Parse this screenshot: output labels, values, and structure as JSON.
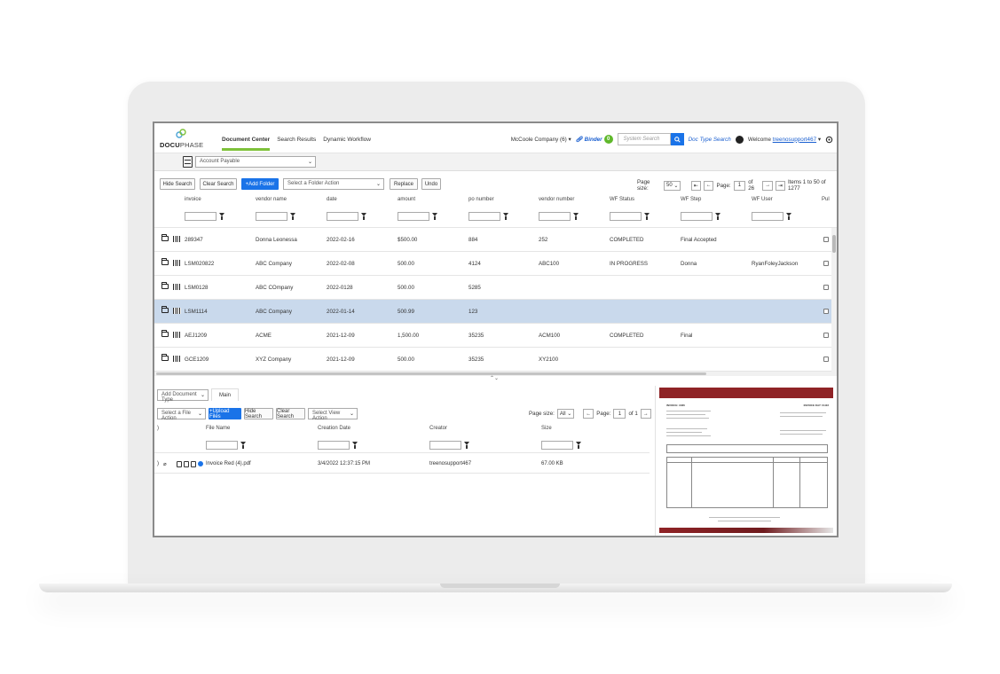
{
  "header": {
    "logo_text_bold": "DOCU",
    "logo_text_rest": "PHASE",
    "tabs": [
      {
        "label": "Document Center",
        "active": true
      },
      {
        "label": "Search Results",
        "active": false
      },
      {
        "label": "Dynamic Workflow",
        "active": false
      }
    ],
    "company": "McCoole Company (6)",
    "binder_label": "Binder",
    "binder_count": "0",
    "search_placeholder": "System Search",
    "doc_type_search": "Doc Type Search",
    "welcome_prefix": "Welcome",
    "username": "treenosupport467"
  },
  "subheader": {
    "doc_type_selected": "Account Payable"
  },
  "toolbar": {
    "hide_search": "Hide Search",
    "clear_search": "Clear Search",
    "add_folder": "+Add Folder",
    "folder_action_placeholder": "Select a Folder Action",
    "replace": "Replace",
    "undo": "Undo",
    "page_size_label": "Page size:",
    "page_size": "50",
    "page_label": "Page:",
    "page": "1",
    "of_pages": "of 26",
    "items_range": "Items 1 to 50 of 1277"
  },
  "columns": [
    "invoice",
    "vendor name",
    "date",
    "amount",
    "po number",
    "vendor number",
    "WF Status",
    "WF Step",
    "WF User",
    "Pul"
  ],
  "rows": [
    {
      "invoice": "289347",
      "vendor": "Donna Leonessa",
      "date": "2022-02-16",
      "amount": "$500.00",
      "po": "884",
      "vendor_no": "252",
      "status": "COMPLETED",
      "step": "Final Accepted",
      "user": "",
      "selected": false
    },
    {
      "invoice": "LSM020822",
      "vendor": "ABC Company",
      "date": "2022-02-08",
      "amount": "500.00",
      "po": "4124",
      "vendor_no": "ABC100",
      "status": "IN PROGRESS",
      "step": "Donna",
      "user": "RyanFoleyJackson",
      "selected": false
    },
    {
      "invoice": "LSM0128",
      "vendor": "ABC COmpany",
      "date": "2022-0128",
      "amount": "500.00",
      "po": "5285",
      "vendor_no": "",
      "status": "",
      "step": "",
      "user": "",
      "selected": false
    },
    {
      "invoice": "LSM1114",
      "vendor": "ABC Company",
      "date": "2022-01-14",
      "amount": "500.99",
      "po": "123",
      "vendor_no": "",
      "status": "",
      "step": "",
      "user": "",
      "selected": true
    },
    {
      "invoice": "AEJ1209",
      "vendor": "ACME",
      "date": "2021-12-09",
      "amount": "1,500.00",
      "po": "35235",
      "vendor_no": "ACM100",
      "status": "COMPLETED",
      "step": "Final",
      "user": "",
      "selected": false
    },
    {
      "invoice": "GCE1209",
      "vendor": "XYZ Company",
      "date": "2021-12-09",
      "amount": "500.00",
      "po": "35235",
      "vendor_no": "XY2100",
      "status": "",
      "step": "",
      "user": "",
      "selected": false
    }
  ],
  "bottom": {
    "add_doc_type": "Add Document Type",
    "tab_main": "Main",
    "file_action_placeholder": "Select a File Action",
    "upload_files": "+Upload Files",
    "hide_search": "Hide Search",
    "clear_search": "Clear Search",
    "view_action_placeholder": "Select View Action",
    "page_size_label": "Page size:",
    "page_size": "All",
    "page_label": "Page:",
    "page": "1",
    "of_pages": "of 1",
    "columns": [
      "File Name",
      "Creation Date",
      "Creator",
      "Size"
    ],
    "file": {
      "name": "Invoice Red (4).pdf",
      "date": "3/4/2022 12:37:15 PM",
      "creator": "treenosupport467",
      "size": "67.00 KB"
    }
  },
  "preview": {
    "heading_left": "INVOICE: 3466",
    "heading_right": "INVOICE DAY: 01/22"
  },
  "colors": {
    "accent_blue": "#1a73e8",
    "active_tab_green": "#7ec13a",
    "selected_row": "#c9d9ec",
    "invoice_red": "#8f2326"
  }
}
